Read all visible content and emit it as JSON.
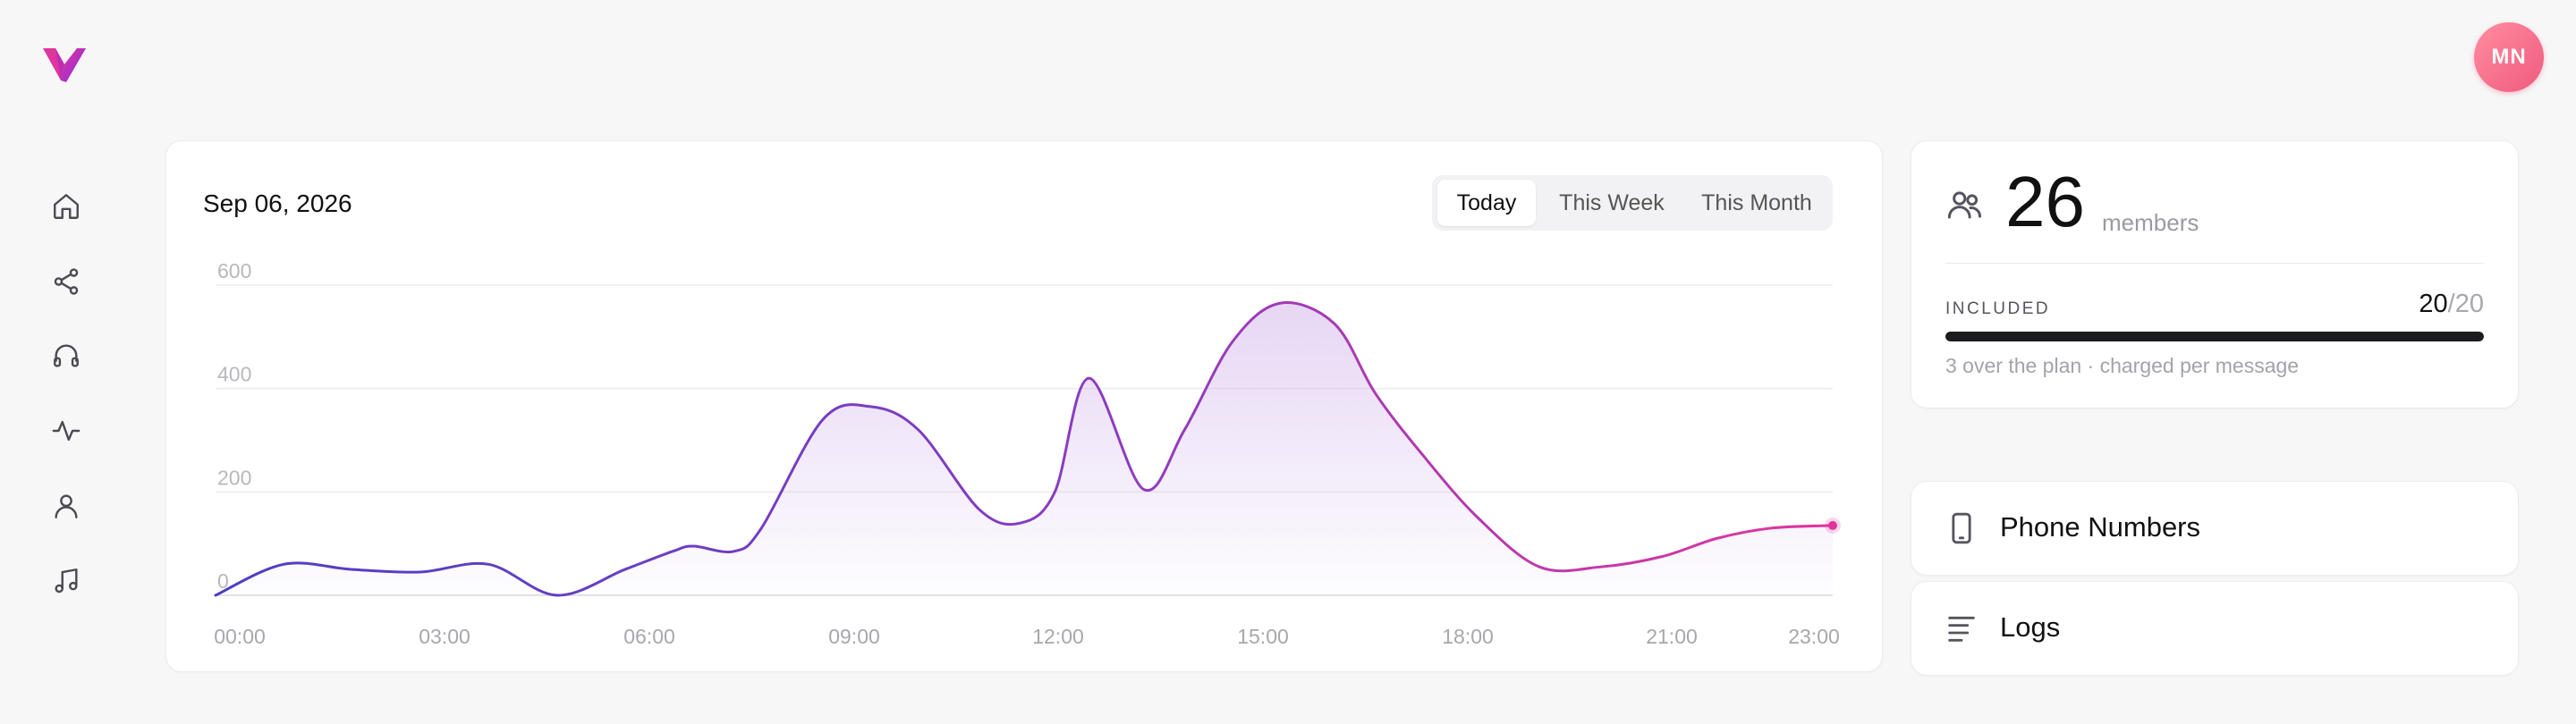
{
  "app": {
    "avatar_initials": "MN",
    "brand_colors": {
      "primary": "#e0359d",
      "secondary": "#8a2be2"
    }
  },
  "sidebar": {
    "items": [
      {
        "name": "home",
        "icon": "home-icon"
      },
      {
        "name": "share",
        "icon": "share-icon"
      },
      {
        "name": "support",
        "icon": "headphones-icon"
      },
      {
        "name": "activity",
        "icon": "activity-icon"
      },
      {
        "name": "user",
        "icon": "user-icon"
      },
      {
        "name": "music",
        "icon": "music-icon"
      }
    ]
  },
  "chart_panel": {
    "date": "Sep 06, 2026",
    "tabs": [
      {
        "label": "Today",
        "active": true
      },
      {
        "label": "This Week",
        "active": false
      },
      {
        "label": "This Month",
        "active": false
      }
    ]
  },
  "chart_data": {
    "type": "area",
    "x_labels": [
      "00:00",
      "03:00",
      "06:00",
      "09:00",
      "12:00",
      "15:00",
      "18:00",
      "21:00",
      "23:00"
    ],
    "x": [
      0,
      1,
      2,
      3,
      4,
      5,
      6,
      6.7,
      7,
      7.6,
      8,
      8.9,
      9.6,
      10.3,
      11.2,
      11.8,
      12.3,
      12.8,
      13.6,
      14.2,
      14.9,
      15.6,
      16.4,
      17.0,
      17.7,
      18.5,
      19.4,
      20.3,
      21.2,
      22.0,
      22.8,
      23.7
    ],
    "y": [
      0,
      60,
      50,
      45,
      60,
      0,
      50,
      85,
      95,
      85,
      130,
      340,
      365,
      320,
      165,
      140,
      200,
      420,
      205,
      320,
      490,
      565,
      525,
      390,
      270,
      150,
      55,
      55,
      75,
      110,
      130,
      135
    ],
    "series": [
      {
        "name": "",
        "color_start": "#4a3fc4",
        "color_end": "#e0359d"
      }
    ],
    "yticks": [
      0,
      200,
      400,
      600
    ],
    "ylim": [
      0,
      600
    ],
    "xlim": [
      0,
      23.7
    ],
    "grid": true,
    "title": "",
    "xlabel": "",
    "ylabel": ""
  },
  "members": {
    "count": "26",
    "label": "members",
    "included_label": "INCLUDED",
    "included_used": "20",
    "included_separator": "/",
    "included_total": "20",
    "usage_fraction": 1.0,
    "over_text": "3 over the plan · charged per message"
  },
  "links": [
    {
      "label": "Phone Numbers",
      "icon": "smartphone-icon"
    },
    {
      "label": "Logs",
      "icon": "logs-icon"
    }
  ]
}
